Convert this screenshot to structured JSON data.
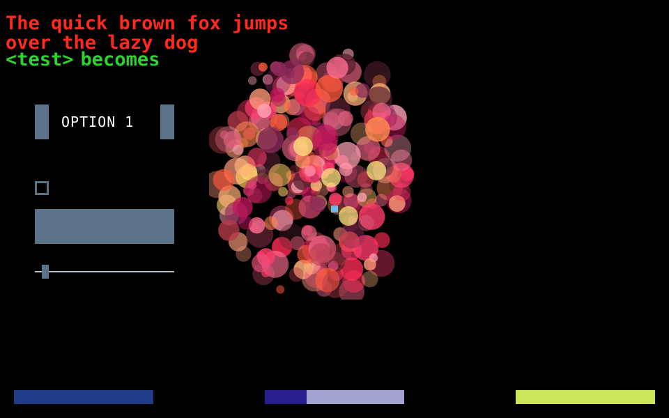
{
  "text": {
    "line1": "The quick brown fox jumps",
    "line2": "over the lazy dog",
    "tag": "<test>",
    "becomes": "becomes"
  },
  "colors": {
    "red_text": "#ff2a1f",
    "green_text": "#2ed32e",
    "control": "#5a7388",
    "bar_left": "#1f3a86",
    "bar_mid_fill": "#28208f",
    "bar_mid_track": "#a3a3d2",
    "bar_right": "#cce65b"
  },
  "option": {
    "label": "OPTION 1"
  },
  "checkbox": {
    "checked": false
  },
  "slider": {
    "value": 0.05
  },
  "bars": {
    "middle_progress": 0.3
  }
}
